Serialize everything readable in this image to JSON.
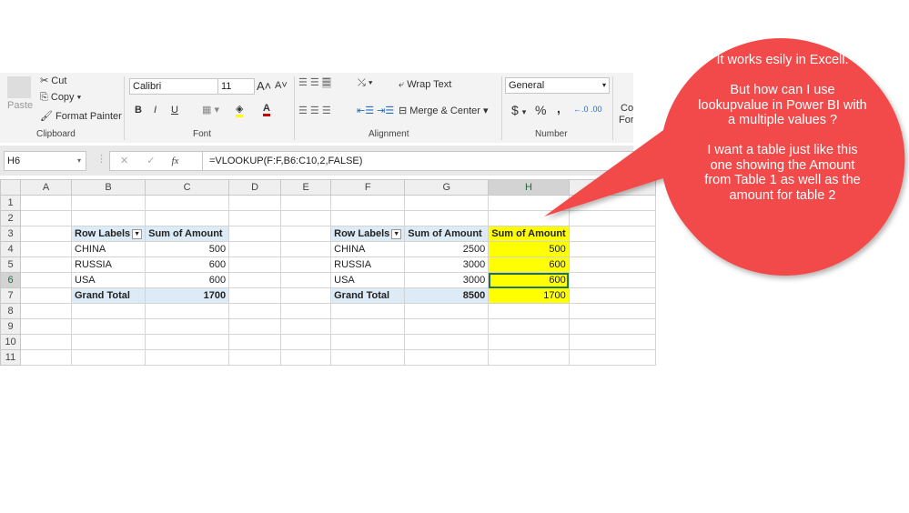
{
  "ribbon": {
    "clipboard": {
      "paste": "Paste",
      "cut": "Cut",
      "copy": "Copy",
      "format_painter": "Format Painter",
      "label": "Clipboard"
    },
    "font": {
      "name": "Calibri",
      "size": "11",
      "label": "Font",
      "bold": "B",
      "italic": "I",
      "underline": "U"
    },
    "alignment": {
      "wrap_text": "Wrap Text",
      "merge_center": "Merge & Center",
      "label": "Alignment"
    },
    "number": {
      "format": "General",
      "currency": "$",
      "percent": "%",
      "comma": ",",
      "label": "Number"
    },
    "styles": {
      "partial_line1": "Co",
      "partial_line2": "For"
    }
  },
  "formula_bar": {
    "name_box": "H6",
    "fx": "fx",
    "formula": "=VLOOKUP(F:F,B6:C10,2,FALSE)"
  },
  "columns": [
    "A",
    "B",
    "C",
    "D",
    "E",
    "F",
    "G",
    "H",
    "I"
  ],
  "rows": [
    "1",
    "2",
    "3",
    "4",
    "5",
    "6",
    "7",
    "8",
    "9",
    "10",
    "11"
  ],
  "pivot1": {
    "headers": [
      "Row Labels",
      "Sum of Amount"
    ],
    "rows": [
      [
        "CHINA",
        "500"
      ],
      [
        "RUSSIA",
        "600"
      ],
      [
        "USA",
        "600"
      ]
    ],
    "total": [
      "Grand Total",
      "1700"
    ]
  },
  "pivot2": {
    "headers": [
      "Row Labels",
      "Sum of Amount",
      "Sum of Amount"
    ],
    "rows": [
      [
        "CHINA",
        "2500",
        "500"
      ],
      [
        "RUSSIA",
        "3000",
        "600"
      ],
      [
        "USA",
        "3000",
        "600"
      ]
    ],
    "total": [
      "Grand Total",
      "8500",
      "1700"
    ]
  },
  "callout": {
    "color": "#f24a4a",
    "line1": "It works esily in Excell.",
    "line2": "But how can I use lookupvalue in Power BI with a multiple values ?",
    "line3": "I want a table just like this one showing the Amount from Table 1 as well as the amount for table 2"
  }
}
